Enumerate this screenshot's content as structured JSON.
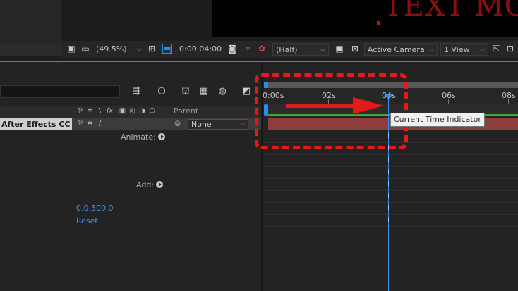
{
  "composition": {
    "canvas_text": "TEXT MO"
  },
  "viewer_toolbar": {
    "magnification": "(49.5%)",
    "timecode": "0:00:04:00",
    "resolution": "(Half)",
    "camera": "Active Camera",
    "view_layout": "1 View"
  },
  "timeline": {
    "columns": {
      "switches": "⅌ ✲ \\ fx ▣ ◎ ◑ ⬡",
      "parent": "Parent"
    },
    "layer": {
      "name": "After Effects CC",
      "parent_value": "None"
    },
    "properties": {
      "animate_label": "Animate:",
      "add_label": "Add:",
      "value": "0.0,500.0",
      "reset_link": "Reset"
    },
    "ruler": {
      "ticks": [
        "0:00s",
        "02s",
        "04s",
        "06s",
        "08s"
      ]
    },
    "current_time_indicator": {
      "tooltip": "Current Time Indicator"
    }
  },
  "colors": {
    "accent_blue": "#2d8ceb",
    "annotation_red": "#e21a1a",
    "layer_bar": "#8e3d3d",
    "work_area_green": "#3fa33f"
  }
}
